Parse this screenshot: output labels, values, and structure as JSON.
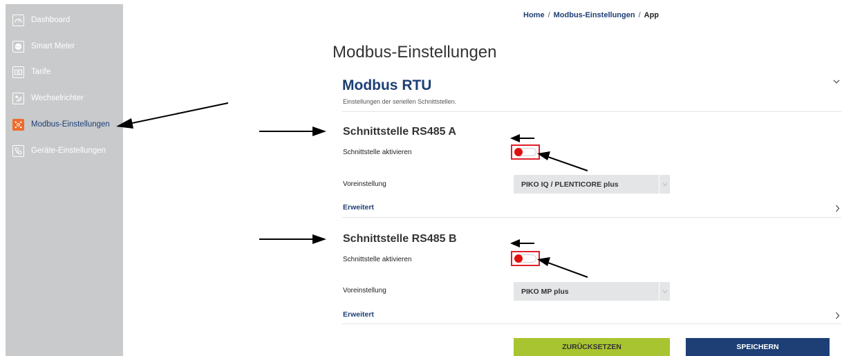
{
  "sidebar": {
    "items": [
      {
        "label": "Dashboard",
        "icon": "gauge-icon",
        "active": false
      },
      {
        "label": "Smart Meter",
        "icon": "meter-icon",
        "active": false
      },
      {
        "label": "Tarife",
        "icon": "tariff-icon",
        "active": false
      },
      {
        "label": "Wechselrichter",
        "icon": "inverter-icon",
        "active": false
      },
      {
        "label": "Modbus-Einstellungen",
        "icon": "modbus-icon",
        "active": true
      },
      {
        "label": "Geräte-Einstellungen",
        "icon": "device-settings-icon",
        "active": false
      }
    ]
  },
  "breadcrumb": {
    "home": "Home",
    "sep": "/",
    "section": "Modbus-Einstellungen",
    "current": "App"
  },
  "page_title": "Modbus-Einstellungen",
  "section": {
    "title": "Modbus RTU",
    "subtitle": "Einstellungen der seriellen Schnittstellen."
  },
  "interfaces": [
    {
      "title": "Schnittstelle RS485 A",
      "enable_label": "Schnittstelle aktivieren",
      "enabled": false,
      "preset_label": "Voreinstellung",
      "preset_value": "PIKO IQ / PLENTICORE plus",
      "advanced_label": "Erweitert"
    },
    {
      "title": "Schnittstelle RS485 B",
      "enable_label": "Schnittstelle aktivieren",
      "enabled": false,
      "preset_label": "Voreinstellung",
      "preset_value": "PIKO MP plus",
      "advanced_label": "Erweitert"
    }
  ],
  "buttons": {
    "reset": "ZURÜCKSETZEN",
    "save": "SPEICHERN"
  },
  "colors": {
    "accent_blue": "#1d3f75",
    "active_orange": "#f06a2a",
    "reset_green": "#a8c430",
    "highlight_red": "#e0202a",
    "sidebar_bg": "#c8cacb"
  }
}
